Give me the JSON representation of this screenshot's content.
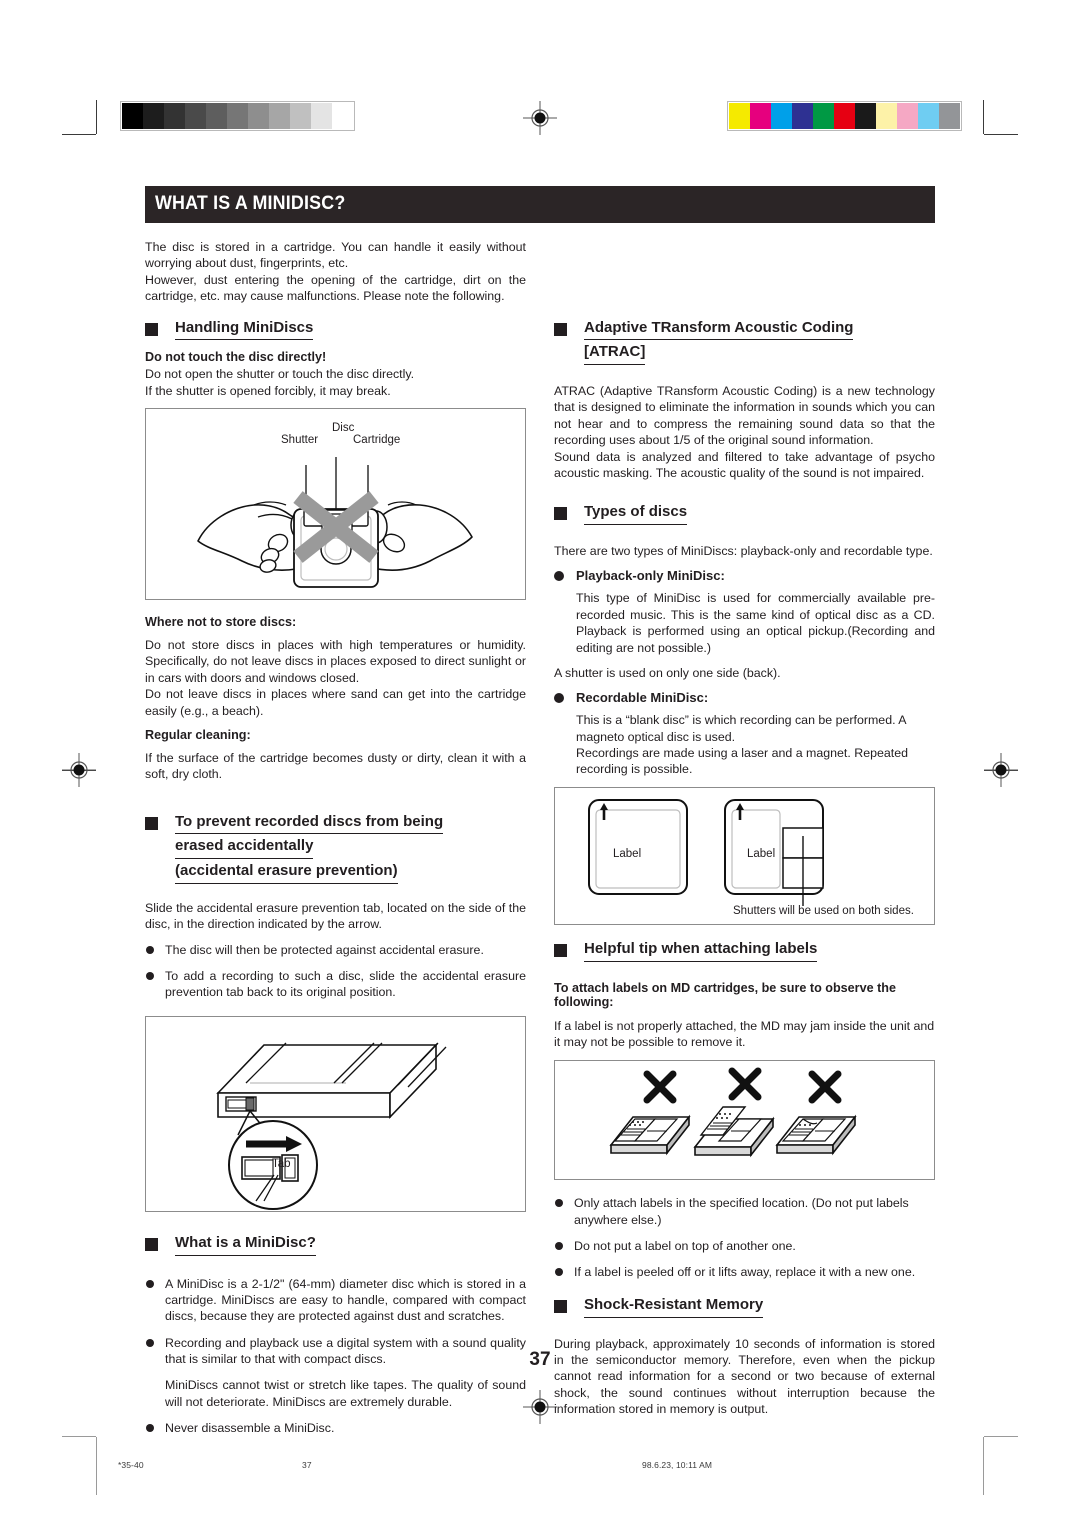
{
  "print_marks": {
    "grayscale_wedge": [
      "#000000",
      "#1d1d1d",
      "#333333",
      "#4a4a4a",
      "#5e5e5e",
      "#767676",
      "#8e8e8e",
      "#a6a6a6",
      "#c0c0c0",
      "#e4e4e4",
      "#ffffff"
    ],
    "color_bar": [
      "#f5ea00",
      "#e6007e",
      "#00a0e9",
      "#2e3192",
      "#009944",
      "#e60012",
      "#1a1a1a",
      "#fdf2a8",
      "#f5a8c4",
      "#6fcdf2",
      "#939598"
    ],
    "registration_mark_name": "registration-target-icon"
  },
  "header": {
    "title": "WHAT IS A MINIDISC?"
  },
  "intro": {
    "paragraph": "The disc is stored in a cartridge.  You can handle it easily without worrying about dust, fingerprints, etc.",
    "paragraph2": "However, dust entering the opening of the cartridge, dirt on the cartridge, etc. may cause malfunctions.  Please note the following."
  },
  "left_column": {
    "handling": {
      "heading": "Handling MiniDiscs",
      "sub1": "Do not touch the disc directly!",
      "body1": "Do not open the shutter or touch the disc directly.",
      "body2": "If the shutter is opened forcibly, it may break.",
      "figure": {
        "name": "handling-minidisc-figure",
        "labels": {
          "disc": "Disc",
          "shutter": "Shutter",
          "cartridge": "Cartridge"
        }
      },
      "sub2": "Where not to store discs:",
      "body3": "Do not store discs in places with high temperatures or humidity. Specifically, do not leave discs in places exposed to direct sunlight or in cars with doors and windows closed.",
      "body4": "Do not leave discs in places where sand can get into the cartridge easily (e.g., a beach).",
      "sub3": "Regular cleaning:",
      "body5": "If the surface of the cartridge becomes dusty or dirty, clean it with a soft, dry cloth."
    },
    "erasure": {
      "heading_line1": "To prevent recorded discs from being",
      "heading_line2": "erased accidentally",
      "heading_line3": "(accidental erasure prevention)",
      "body1": "Slide the accidental erasure prevention tab, located on the side of the disc, in the direction indicated by the arrow.",
      "bullets": [
        "The disc will then be protected against accidental erasure.",
        "To add a recording to such a disc, slide the accidental erasure prevention tab back to its original position."
      ],
      "figure": {
        "name": "erasure-prevention-tab-figure",
        "label_tab": "Tab"
      }
    },
    "what_is": {
      "heading": "What is a MiniDisc?",
      "bullets": [
        "A MiniDisc is a 2-1/2\" (64-mm) diameter disc which is stored in a cartridge.  MiniDiscs are easy to handle, compared with compact discs, because they are protected against dust and scratches.",
        "Recording and playback use a digital system with a sound quality that is similar to that with compact discs."
      ],
      "note": "MiniDiscs cannot twist or stretch like tapes.  The quality of sound will not deteriorate.  MiniDiscs are extremely durable.",
      "last_bullet": "Never disassemble a MiniDisc."
    }
  },
  "right_column": {
    "atrac": {
      "heading_line1": "Adaptive TRansform Acoustic Coding",
      "heading_line2": "[ATRAC]",
      "body1": "ATRAC (Adaptive TRansform Acoustic Coding) is a new technology that is designed to eliminate the information in sounds which you can not hear and to compress the remaining sound data so that the recording uses about 1/5 of the original sound information.",
      "body2": "Sound data is analyzed and filtered to take advantage of psycho acoustic masking.  The acoustic quality of the sound is not impaired."
    },
    "types": {
      "heading": "Types of discs",
      "intro": "There are two types of MiniDiscs: playback-only and recordable type.",
      "item1_head": "Playback-only MiniDisc:",
      "item1_body": "This type of MiniDisc is used for commercially available pre-recorded music.  This is the same kind of optical disc as a CD.  Playback is performed using an optical pickup.(Recording and editing are not possible.)",
      "item1_note": "A shutter is used on only one side (back).",
      "item2_head": "Recordable MiniDisc:",
      "item2_body": "This is a “blank disc” is which recording can be performed.  A magneto optical disc is used.",
      "item2_body2": "Recordings are made using a laser and a magnet.  Repeated recording is possible.",
      "figure": {
        "name": "disc-types-figure",
        "label_left": "Label",
        "label_right": "Label",
        "caption": "Shutters will be used on both sides."
      }
    },
    "labels_tip": {
      "heading": "Helpful tip when attaching labels",
      "sub": "To attach labels on MD cartridges, be sure to observe the following:",
      "body": " If a label is not properly attached, the MD may jam inside the unit and it may not be possible to remove it.",
      "figure": {
        "name": "label-attachment-dont-figure",
        "cross_count": 3
      },
      "bullets": [
        "Only attach labels in the specified location. (Do not put labels anywhere else.)",
        "Do not put a label on top of another one.",
        "If a label is peeled off or it lifts away, replace it with a new one."
      ]
    },
    "shock": {
      "heading": "Shock-Resistant Memory",
      "body": "During playback, approximately 10 seconds of information is stored in the semiconductor memory.  Therefore, even when the pickup cannot read information for a second or two because of external shock, the sound continues without interruption because the information stored in memory is output."
    }
  },
  "footer": {
    "page_number": "37",
    "file_ref": "*35-40",
    "folio": "37",
    "timestamp": "98.6.23, 10:11 AM"
  }
}
